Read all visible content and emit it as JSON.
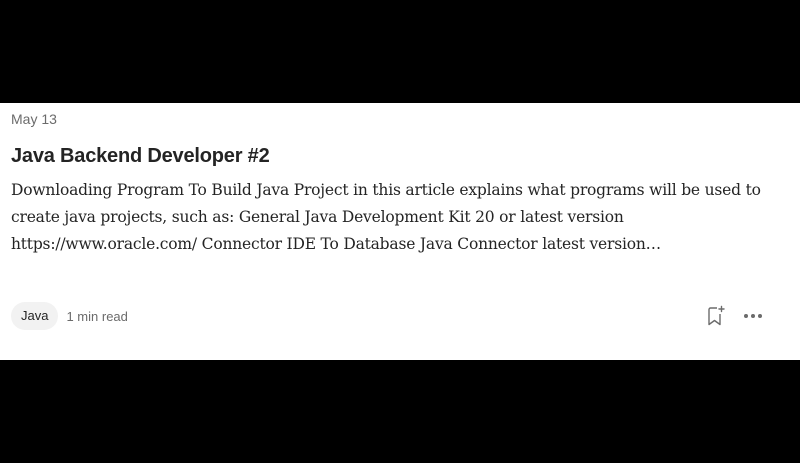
{
  "post": {
    "date": "May 13",
    "title": "Java Backend Developer #2",
    "excerpt": "Downloading Program To Build Java Project in this article explains what programs will be used to create java projects, such as: General Java Development Kit 20 or latest version https://www.oracle.com/ Connector IDE To Database Java Connector latest version…",
    "tag": "Java",
    "read_time": "1 min read"
  },
  "icons": {
    "save": "bookmark-add-icon",
    "more": "more-horizontal-icon"
  },
  "colors": {
    "background": "#000000",
    "card": "#ffffff",
    "text_primary": "#242424",
    "text_secondary": "#6b6b6b",
    "tag_background": "#f2f2f2"
  }
}
